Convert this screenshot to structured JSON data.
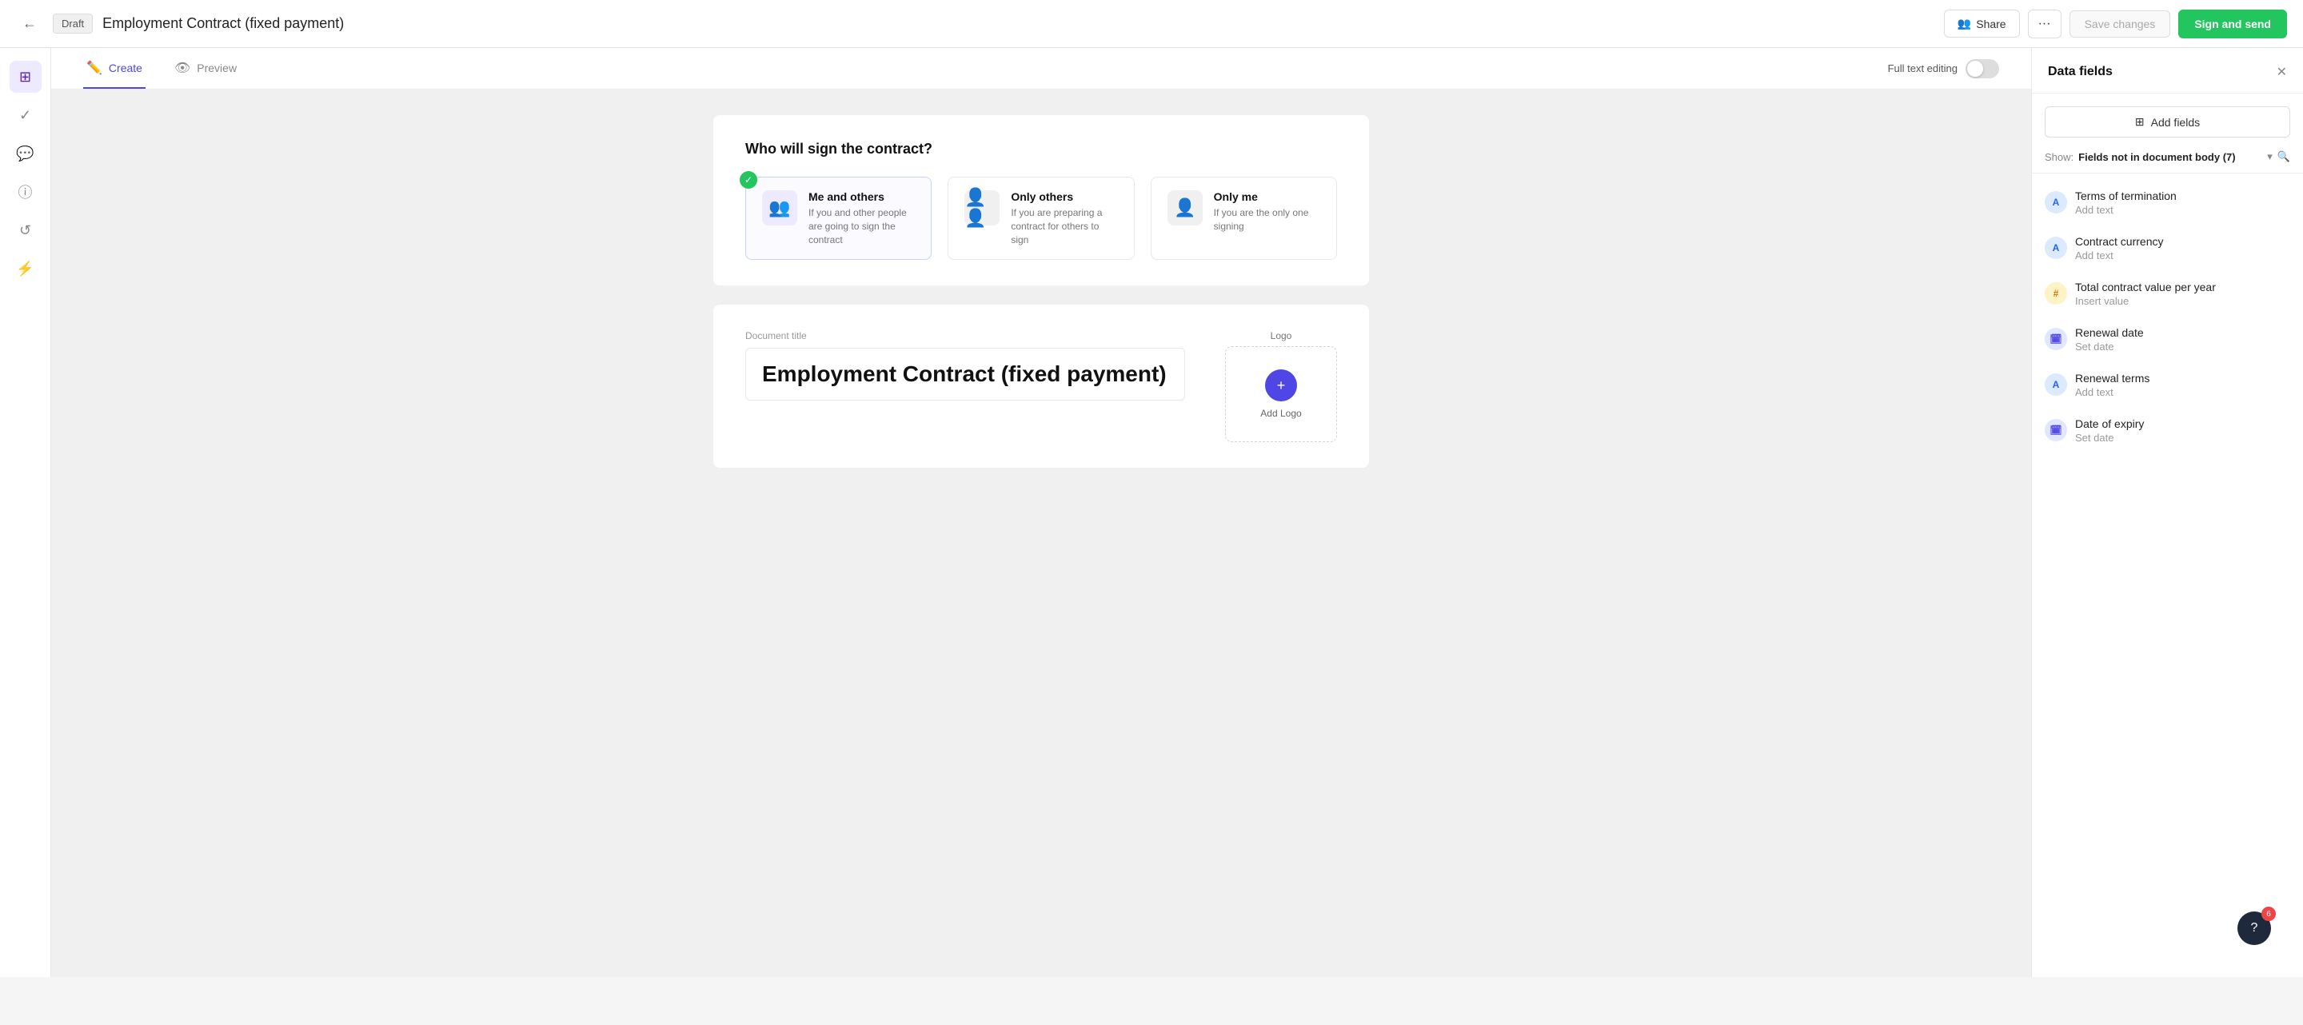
{
  "topbar": {
    "back_label": "←",
    "draft_label": "Draft",
    "document_title": "Employment Contract (fixed payment)",
    "share_label": "Share",
    "more_label": "···",
    "save_label": "Save changes",
    "sign_label": "Sign and send"
  },
  "tabs": {
    "create_label": "Create",
    "preview_label": "Preview",
    "full_text_label": "Full text editing"
  },
  "signer_section": {
    "title": "Who will sign the contract?",
    "options": [
      {
        "id": "me-and-others",
        "label": "Me and others",
        "description": "If you and other people are going to sign the contract",
        "selected": true
      },
      {
        "id": "only-others",
        "label": "Only others",
        "description": "If you are preparing a contract for others to sign",
        "selected": false
      },
      {
        "id": "only-me",
        "label": "Only me",
        "description": "If you are the only one signing",
        "selected": false
      }
    ]
  },
  "doc_preview": {
    "title_label": "Document title",
    "title_value": "Employment Contract (fixed payment)",
    "logo_label": "Logo",
    "add_logo_label": "Add Logo"
  },
  "data_fields": {
    "panel_title": "Data fields",
    "add_fields_label": "Add fields",
    "show_label": "Show:",
    "filter_value": "Fields not in document body",
    "filter_count": "(7)",
    "fields": [
      {
        "id": "terms-of-termination",
        "name": "Terms of termination",
        "placeholder": "Add text",
        "type": "text",
        "icon_label": "A"
      },
      {
        "id": "contract-currency",
        "name": "Contract currency",
        "placeholder": "Add text",
        "type": "text",
        "icon_label": "A"
      },
      {
        "id": "total-contract-value",
        "name": "Total contract value per year",
        "placeholder": "Insert value",
        "type": "number",
        "icon_label": "#"
      },
      {
        "id": "renewal-date",
        "name": "Renewal date",
        "placeholder": "Set date",
        "type": "date",
        "icon_label": "📅"
      },
      {
        "id": "renewal-terms",
        "name": "Renewal terms",
        "placeholder": "Add text",
        "type": "text",
        "icon_label": "A"
      },
      {
        "id": "date-of-expiry",
        "name": "Date of expiry",
        "placeholder": "Set date",
        "type": "date",
        "icon_label": "📅"
      }
    ]
  },
  "help": {
    "notification_count": "6",
    "icon_label": "?"
  }
}
